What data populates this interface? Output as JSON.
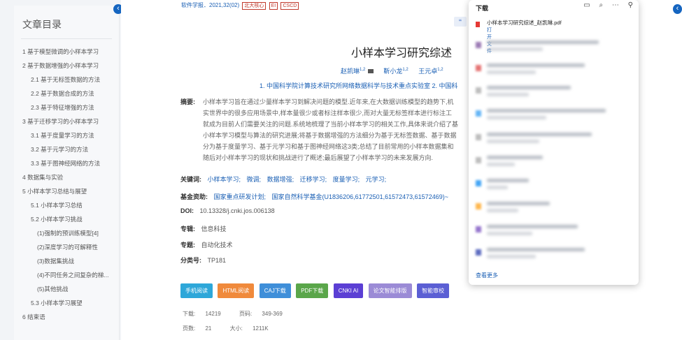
{
  "sidebar": {
    "title": "文章目录",
    "items": [
      {
        "label": "1 基于模型微调的小样本学习",
        "level": 1
      },
      {
        "label": "2 基于数据增强的小样本学习",
        "level": 1
      },
      {
        "label": "2.1 基于无标签数据的方法",
        "level": 2
      },
      {
        "label": "2.2 基于数据合成的方法",
        "level": 2
      },
      {
        "label": "2.3 基于特征增强的方法",
        "level": 2
      },
      {
        "label": "3 基于迁移学习的小样本学习",
        "level": 1
      },
      {
        "label": "3.1 基于度量学习的方法",
        "level": 2
      },
      {
        "label": "3.2 基于元学习的方法",
        "level": 2
      },
      {
        "label": "3.3 基于图神经网络的方法",
        "level": 2
      },
      {
        "label": "4 数据集与实验",
        "level": 1
      },
      {
        "label": "5 小样本学习总结与展望",
        "level": 1
      },
      {
        "label": "5.1 小样本学习总结",
        "level": 2
      },
      {
        "label": "5.2 小样本学习挑战",
        "level": 2
      },
      {
        "label": "(1)强制的预训练模型[4]",
        "level": 3
      },
      {
        "label": "(2)深度学习的可解释性",
        "level": 3
      },
      {
        "label": "(3)数据集挑战",
        "level": 3
      },
      {
        "label": "(4)不同任务之间复杂的梯...",
        "level": 3
      },
      {
        "label": "(5)其他挑战",
        "level": 3
      },
      {
        "label": "5.3 小样本学习展望",
        "level": 2
      },
      {
        "label": "6 结束语",
        "level": 1
      }
    ]
  },
  "article": {
    "journal": "软件学报．2021,32(02)",
    "tags": [
      "北大核心",
      "EI",
      "CSCD"
    ],
    "title": "小样本学习研究综述",
    "authors": [
      {
        "name": "赵凯琳",
        "sup": "1,2"
      },
      {
        "name": "靳小龙",
        "sup": "1,2"
      },
      {
        "name": "王元卓",
        "sup": "1,2"
      }
    ],
    "affiliation": "1. 中国科学院计算技术研究所网络数据科学与技术重点实验室  2. 中国科",
    "abstract_label": "摘要:",
    "abstract_lines": [
      "小样本学习旨在通过少量样本学习到解决问题的模型.近年来,在大数据训练模型的趋势下,机",
      "实世界中的很多应用场景中,样本量很少或者标注样本很少,而对大量无标签样本进行标注工",
      "就成为目前人们需要关注的问题.系统地梳理了当前小样本学习的相关工作,具体来说介绍了基",
      "小样本学习模型与算法的研究进展;将基于数据增强的方法细分为基于无标签数据、基于数据",
      "分为基于度量学习、基于元学习和基于图神经网络这3类;总结了目前常用的小样本数据集和",
      "随后对小样本学习的现状和挑战进行了概述;最后展望了小样本学习的未来发展方向."
    ],
    "keywords_label": "关键词:",
    "keywords": [
      "小样本学习;",
      "微调;",
      "数据增强;",
      "迁移学习;",
      "度量学习;",
      "元学习;"
    ],
    "fund_label": "基金资助:",
    "fund": [
      "国家重点研发计划;",
      "国家自然科学基金(U1836206,61772501,61572473,61572469)~"
    ],
    "doi_label": "DOI:",
    "doi": "10.13328/j.cnki.jos.006138",
    "series_label": "专辑:",
    "series": "信息科技",
    "topic_label": "专题:",
    "topic": "自动化技术",
    "class_label": "分类号:",
    "class": "TP181"
  },
  "actions": [
    {
      "label": "手机阅读",
      "color": "#2ea7d9"
    },
    {
      "label": "HTML阅读",
      "color": "#f08a3c"
    },
    {
      "label": "CAJ下载",
      "color": "#3f8fd9"
    },
    {
      "label": "PDF下载",
      "color": "#5aa64a"
    },
    {
      "label": "CNKI AI",
      "color": "#5b3fd4"
    },
    {
      "label": "论文智能排版",
      "color": "#9b8bd6"
    },
    {
      "label": "智能审校",
      "color": "#5b5fd4"
    }
  ],
  "stats": {
    "downloads_label": "下载:",
    "downloads": "14219",
    "pages_label": "页码:",
    "pages": "349-369",
    "page_count_label": "页数:",
    "page_count": "21",
    "size_label": "大小:",
    "size": "1211K"
  },
  "downloads_panel": {
    "title": "下载",
    "file_name": "小样本学习研究综述_赵凯琳.pdf",
    "open_label": "打开文件",
    "more_label": "查看更多",
    "icons": [
      "folder-icon",
      "search-icon",
      "more-icon",
      "pin-icon"
    ]
  }
}
